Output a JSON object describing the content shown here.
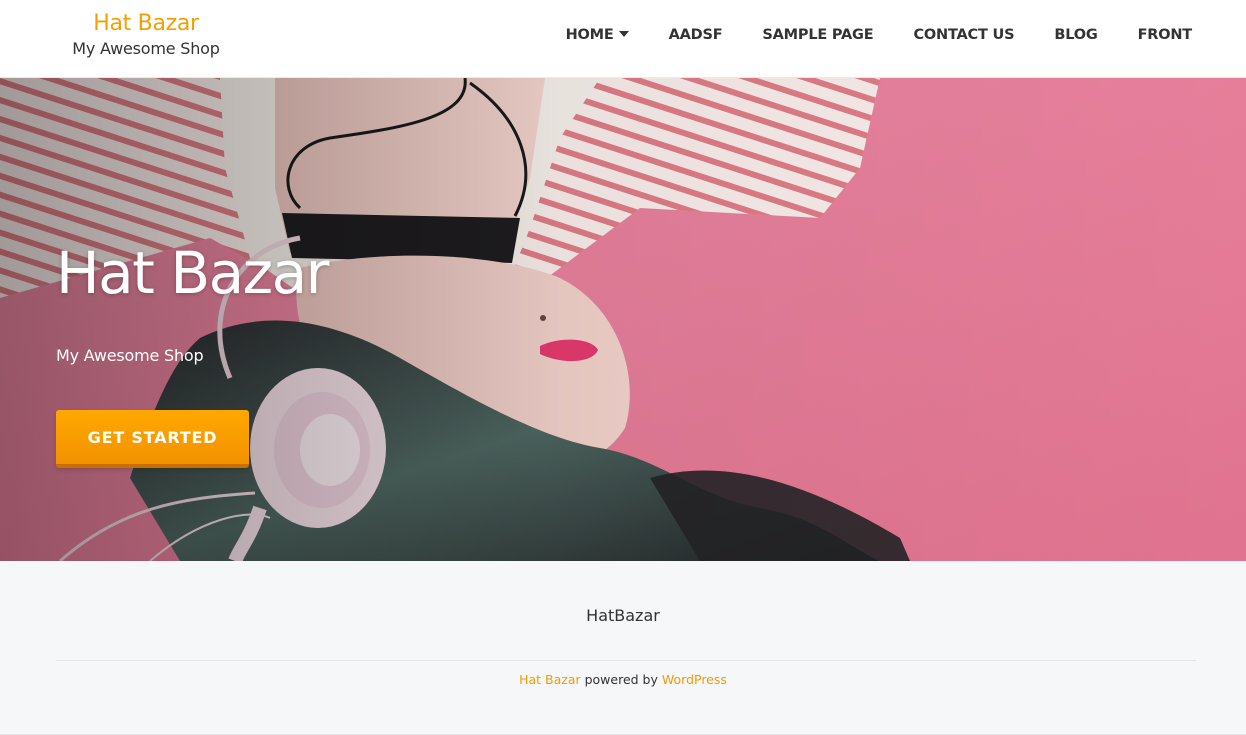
{
  "header": {
    "site_title": "Hat Bazar",
    "tagline": "My Awesome Shop",
    "nav": [
      {
        "label": "HOME",
        "has_dropdown": true
      },
      {
        "label": "AADSF",
        "has_dropdown": false
      },
      {
        "label": "SAMPLE PAGE",
        "has_dropdown": false
      },
      {
        "label": "CONTACT US",
        "has_dropdown": false
      },
      {
        "label": "BLOG",
        "has_dropdown": false
      },
      {
        "label": "FRONT",
        "has_dropdown": false
      }
    ]
  },
  "hero": {
    "title": "Hat Bazar",
    "subtitle": "My Awesome Shop",
    "cta_label": "GET STARTED"
  },
  "footer": {
    "site_name": "HatBazar",
    "credit_theme": "Hat Bazar",
    "credit_text": " powered by ",
    "credit_platform": "WordPress"
  },
  "colors": {
    "accent": "#f5a000",
    "hero_background": "#e47d99",
    "footer_background": "#f6f7f9"
  }
}
